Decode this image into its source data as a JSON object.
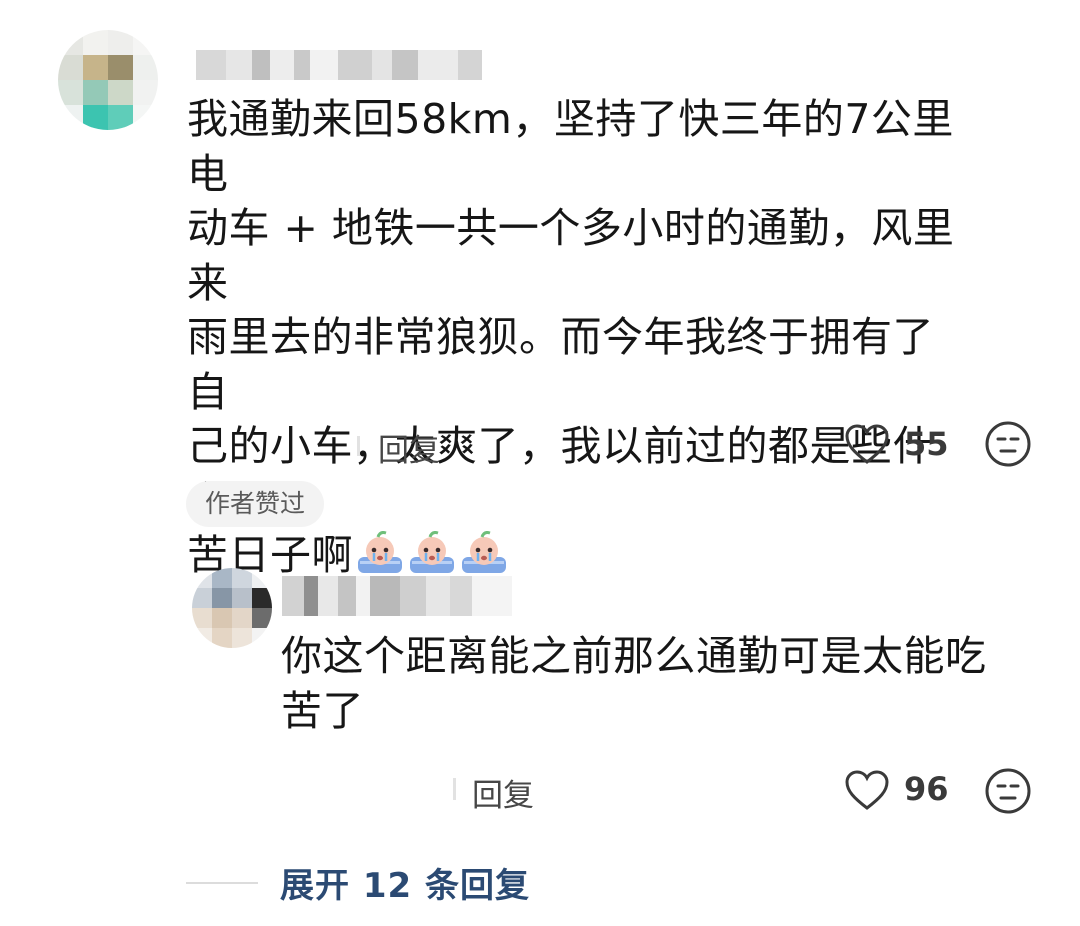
{
  "comments": [
    {
      "text_line1": "我通勤来回58km，坚持了快三年的7公里电",
      "text_line2": "动车 + 地铁一共一个多小时的通勤，风里来",
      "text_line3": "雨里去的非常狼狈。而今年我终于拥有了自",
      "text_line4": "己的小车，太爽了，我以前过的都是些什么",
      "text_line5": "苦日子啊",
      "emoji_icon": "crying-face-emoji",
      "reply_label": "回复",
      "like_count": "55",
      "author_badge": "作者赞过"
    },
    {
      "text_line1": "你这个距离能之前那么通勤可是太能吃",
      "text_line2": "苦了",
      "reply_label": "回复",
      "like_count": "96"
    }
  ],
  "expand_label": "展开 12 条回复",
  "colors": {
    "expand_text": "#2b4a73",
    "badge_bg": "#f3f3f3"
  }
}
